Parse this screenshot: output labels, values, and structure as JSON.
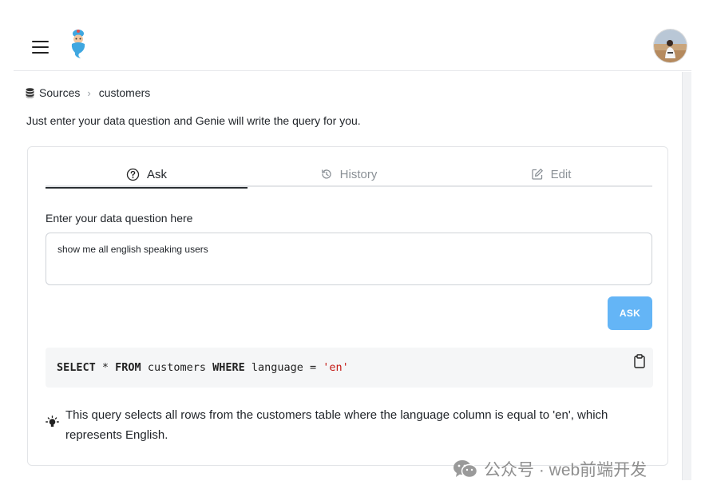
{
  "header": {
    "menu_icon": "hamburger-menu-icon",
    "logo_icon": "genie-logo-icon",
    "avatar_icon": "user-avatar"
  },
  "breadcrumb": {
    "icon": "database-icon",
    "root": "Sources",
    "separator": "›",
    "current": "customers"
  },
  "subtitle": "Just enter your data question and Genie will write the query for you.",
  "tabs": [
    {
      "label": "Ask",
      "icon": "question-circle-icon",
      "active": true
    },
    {
      "label": "History",
      "icon": "history-icon",
      "active": false
    },
    {
      "label": "Edit",
      "icon": "edit-icon",
      "active": false
    }
  ],
  "question": {
    "label": "Enter your data question here",
    "value": "show me all english speaking users"
  },
  "ask_button": "ASK",
  "query": {
    "tokens": [
      "SELECT",
      " * ",
      "FROM",
      " customers ",
      "WHERE",
      " language = ",
      "'en'"
    ],
    "copy_icon": "clipboard-icon"
  },
  "explanation": {
    "icon": "lightbulb-icon",
    "text": "This query selects all rows from the customers table where the language column is equal to 'en', which represents English."
  },
  "watermark": {
    "icon": "wechat-icon",
    "text": "公众号 · web前端开发"
  },
  "colors": {
    "accent_button": "#64b5f6",
    "string_literal": "#c41a16",
    "code_background": "#f5f6f7"
  }
}
